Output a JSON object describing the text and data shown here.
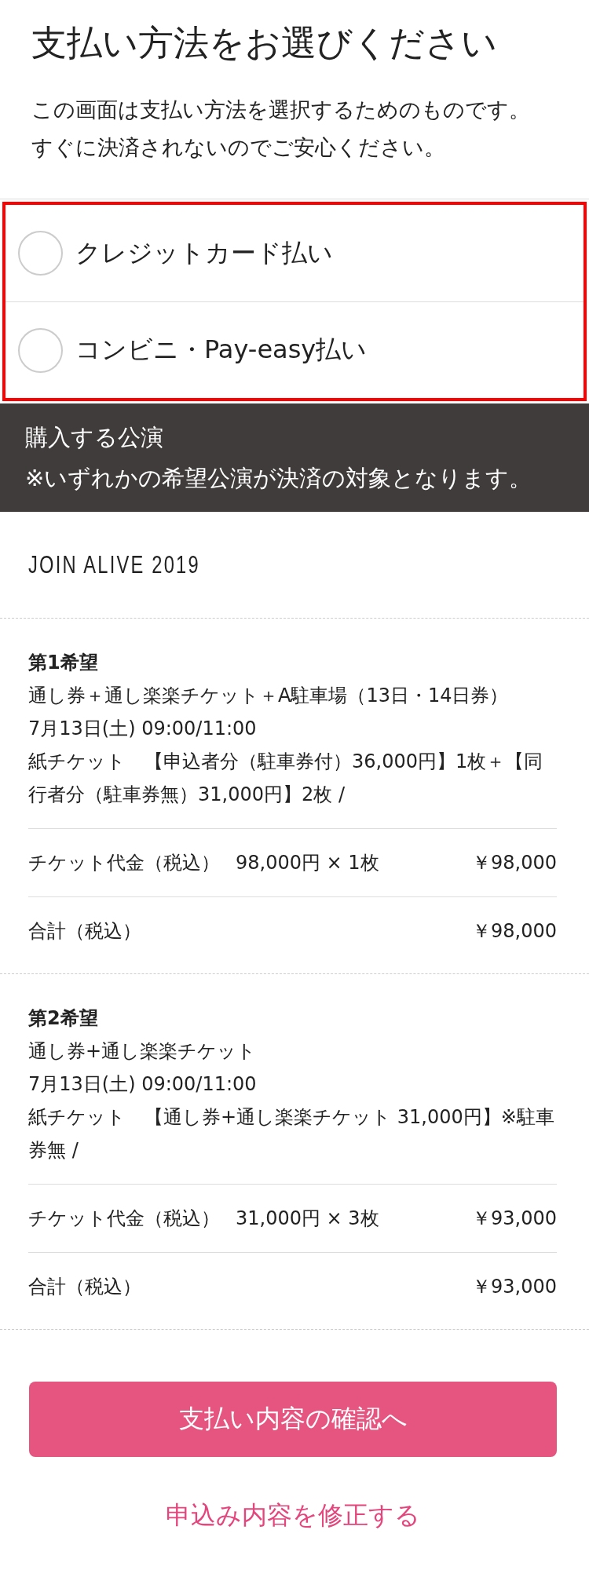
{
  "title": "支払い方法をお選びください",
  "description": [
    "この画面は支払い方法を選択するためのものです。",
    "すぐに決済されないのでご安心ください。"
  ],
  "payment_methods": {
    "highlighted": true,
    "options": [
      {
        "label": "クレジットカード払い",
        "selected": false
      },
      {
        "label": "コンビニ・Pay-easy払い",
        "selected": false
      }
    ]
  },
  "purchase_notice": {
    "heading": "購入する公演",
    "note": "※いずれかの希望公演が決済の対象となります。"
  },
  "event_name": "JOIN ALIVE 2019",
  "choices": [
    {
      "heading": "第1希望",
      "details": [
        "通し券＋通し楽楽チケット＋A駐車場（13日・14日券）",
        "7月13日(土) 09:00/11:00",
        "紙チケット　【申込者分（駐車券付）36,000円】1枚＋【同行者分（駐車券無）31,000円】2枚 /"
      ],
      "ticket_fee": {
        "label": "チケット代金（税込）",
        "detail": "98,000円 × 1枚",
        "amount": "￥98,000"
      },
      "total": {
        "label": "合計（税込）",
        "amount": "￥98,000"
      }
    },
    {
      "heading": "第2希望",
      "details": [
        "通し券+通し楽楽チケット",
        "7月13日(土) 09:00/11:00",
        "紙チケット　【通し券+通し楽楽チケット 31,000円】※駐車券無 /"
      ],
      "ticket_fee": {
        "label": "チケット代金（税込）",
        "detail": "31,000円 × 3枚",
        "amount": "￥93,000"
      },
      "total": {
        "label": "合計（税込）",
        "amount": "￥93,000"
      }
    }
  ],
  "confirm_button": "支払い内容の確認へ",
  "edit_link": "申込み内容を修正する"
}
